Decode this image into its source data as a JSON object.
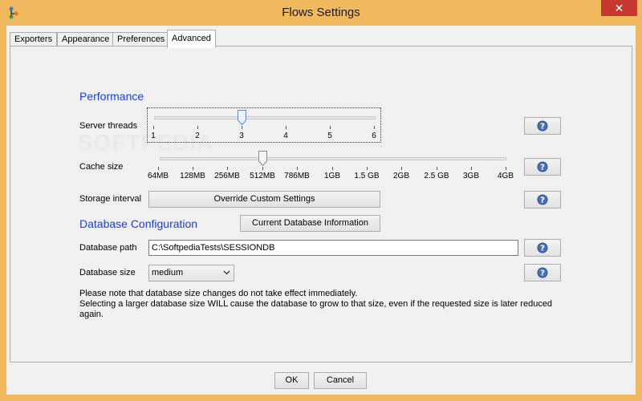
{
  "window": {
    "title": "Flows Settings",
    "close_glyph": "✕"
  },
  "tabs": [
    {
      "label": "Exporters"
    },
    {
      "label": "Appearance"
    },
    {
      "label": "Preferences"
    },
    {
      "label": "Advanced",
      "active": true
    }
  ],
  "watermark": "SOFTPEDIA",
  "performance": {
    "title": "Performance",
    "server_threads": {
      "label": "Server threads",
      "ticks": [
        "1",
        "2",
        "3",
        "4",
        "5",
        "6"
      ],
      "value": "3"
    },
    "cache_size": {
      "label": "Cache size",
      "ticks": [
        "64MB",
        "128MB",
        "256MB",
        "512MB",
        "786MB",
        "1GB",
        "1.5 GB",
        "2GB",
        "2.5 GB",
        "3GB",
        "4GB"
      ],
      "value": "512MB"
    },
    "storage_interval": {
      "label": "Storage interval",
      "button": "Override Custom Settings"
    }
  },
  "database": {
    "title": "Database Configuration",
    "info_button": "Current Database Information",
    "path": {
      "label": "Database path",
      "value": "C:\\SoftpediaTests\\SESSIONDB"
    },
    "size": {
      "label": "Database size",
      "value": "medium"
    },
    "note_lines": [
      "Please note that database size changes do not take effect immediately.",
      "Selecting a larger database size WILL cause the database to grow to that size, even if the requested size is later reduced",
      "again."
    ]
  },
  "footer": {
    "ok": "OK",
    "cancel": "Cancel"
  },
  "colors": {
    "title_bar": "#f0b95e",
    "section_title": "#1b3ed8",
    "close_button": "#c7372f",
    "help_icon": "#4a6fb5"
  },
  "icons": {
    "help": "question-circle-icon",
    "app": "flows-app-icon",
    "chevron": "chevron-down-icon"
  }
}
